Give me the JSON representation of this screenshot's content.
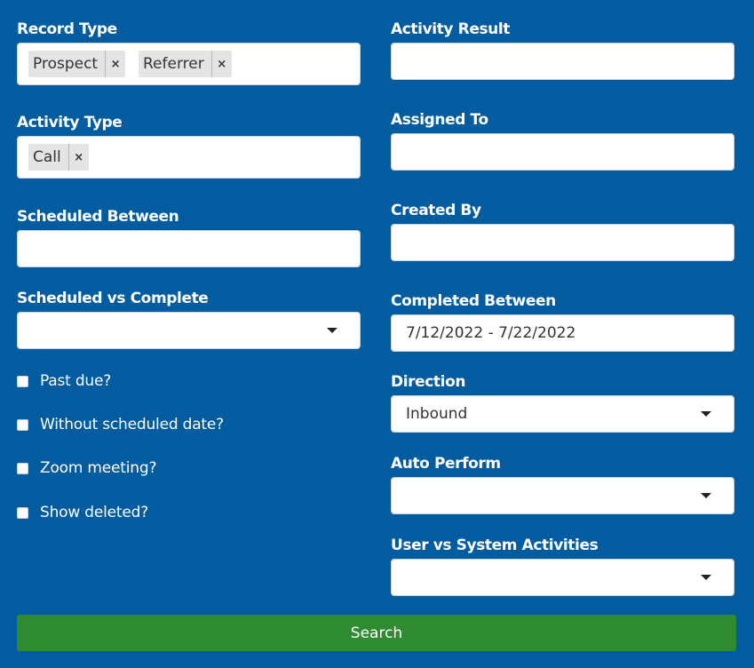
{
  "left": {
    "record_type": {
      "label": "Record Type",
      "tags": [
        "Prospect",
        "Referrer"
      ],
      "remove": "×"
    },
    "activity_type": {
      "label": "Activity Type",
      "tags": [
        "Call"
      ],
      "remove": "×"
    },
    "scheduled_between": {
      "label": "Scheduled Between",
      "value": ""
    },
    "scheduled_vs_complete": {
      "label": "Scheduled vs Complete",
      "value": ""
    },
    "checkboxes": [
      {
        "label": "Past due?",
        "checked": false
      },
      {
        "label": "Without scheduled date?",
        "checked": false
      },
      {
        "label": "Zoom meeting?",
        "checked": false
      },
      {
        "label": "Show deleted?",
        "checked": false
      }
    ]
  },
  "right": {
    "activity_result": {
      "label": "Activity Result",
      "value": ""
    },
    "assigned_to": {
      "label": "Assigned To",
      "value": ""
    },
    "created_by": {
      "label": "Created By",
      "value": ""
    },
    "completed_between": {
      "label": "Completed Between",
      "value": "7/12/2022 - 7/22/2022"
    },
    "direction": {
      "label": "Direction",
      "value": "Inbound"
    },
    "auto_perform": {
      "label": "Auto Perform",
      "value": ""
    },
    "user_vs_system": {
      "label": "User vs System Activities",
      "value": ""
    }
  },
  "search": {
    "label": "Search"
  },
  "colors": {
    "background": "#035ca0",
    "button": "#2e8b30",
    "input": "#ffffff",
    "tag": "#e4e4e4"
  }
}
